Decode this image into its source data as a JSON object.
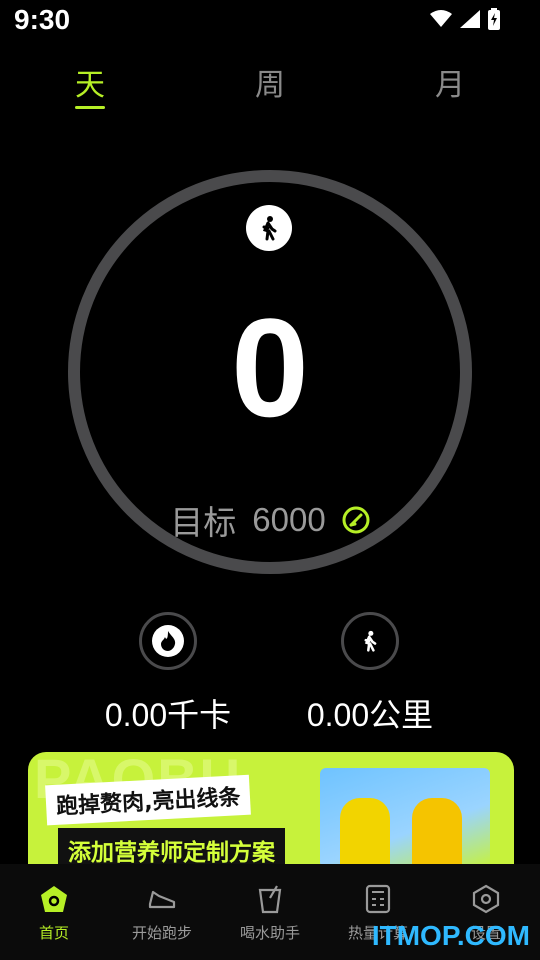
{
  "status_bar": {
    "time": "9:30"
  },
  "tabs": [
    {
      "label": "天",
      "active": true
    },
    {
      "label": "周",
      "active": false
    },
    {
      "label": "月",
      "active": false
    }
  ],
  "ring": {
    "steps": "0",
    "goal_label": "目标",
    "goal_value": "6000"
  },
  "stats": [
    {
      "value": "0.00千卡",
      "icon": "flame-icon"
    },
    {
      "value": "0.00公里",
      "icon": "walk-icon"
    }
  ],
  "banner": {
    "bg_text": "PAOBU",
    "line1": "跑掉赘肉,亮出线条",
    "line2": "添加营养师定制方案"
  },
  "bottom_nav": [
    {
      "label": "首页",
      "active": true
    },
    {
      "label": "开始跑步",
      "active": false
    },
    {
      "label": "喝水助手",
      "active": false
    },
    {
      "label": "热量计算",
      "active": false
    },
    {
      "label": "设置",
      "active": false
    }
  ],
  "watermark": "ITMOP.COM",
  "colors": {
    "accent": "#b6ef26",
    "ring": "#4a4a4c",
    "background": "#000000"
  }
}
